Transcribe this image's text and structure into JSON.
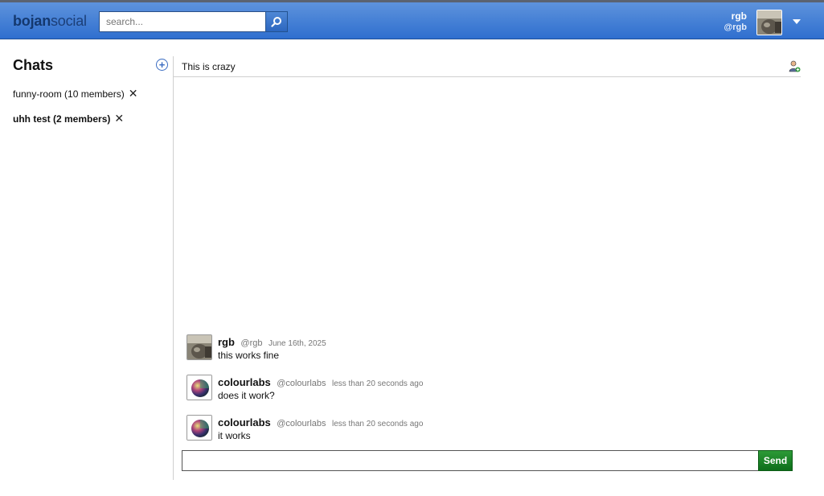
{
  "app": {
    "logo_bold": "bojan",
    "logo_light": "social",
    "search_placeholder": "search...",
    "user": {
      "name": "rgb",
      "handle": "@rgb"
    }
  },
  "sidebar": {
    "title": "Chats",
    "chats": [
      {
        "label": "funny-room (10 members)",
        "active": false
      },
      {
        "label": "uhh test (2 members)",
        "active": true
      }
    ],
    "remove_glyph": "✕"
  },
  "chat": {
    "title": "This is crazy",
    "messages": [
      {
        "user": "rgb",
        "handle": "@rgb",
        "time": "June 16th, 2025",
        "text": "this works fine",
        "avatar": "cat-photo"
      },
      {
        "user": "colourlabs",
        "handle": "@colourlabs",
        "time": "less than 20 seconds ago",
        "text": "does it work?",
        "avatar": "color-wheel"
      },
      {
        "user": "colourlabs",
        "handle": "@colourlabs",
        "time": "less than 20 seconds ago",
        "text": "it works",
        "avatar": "color-wheel"
      }
    ],
    "composer_value": "",
    "send_label": "Send"
  },
  "colors": {
    "topbar": "#3a78d6",
    "send": "#1a7f25",
    "accent": "#3a6cc2"
  }
}
